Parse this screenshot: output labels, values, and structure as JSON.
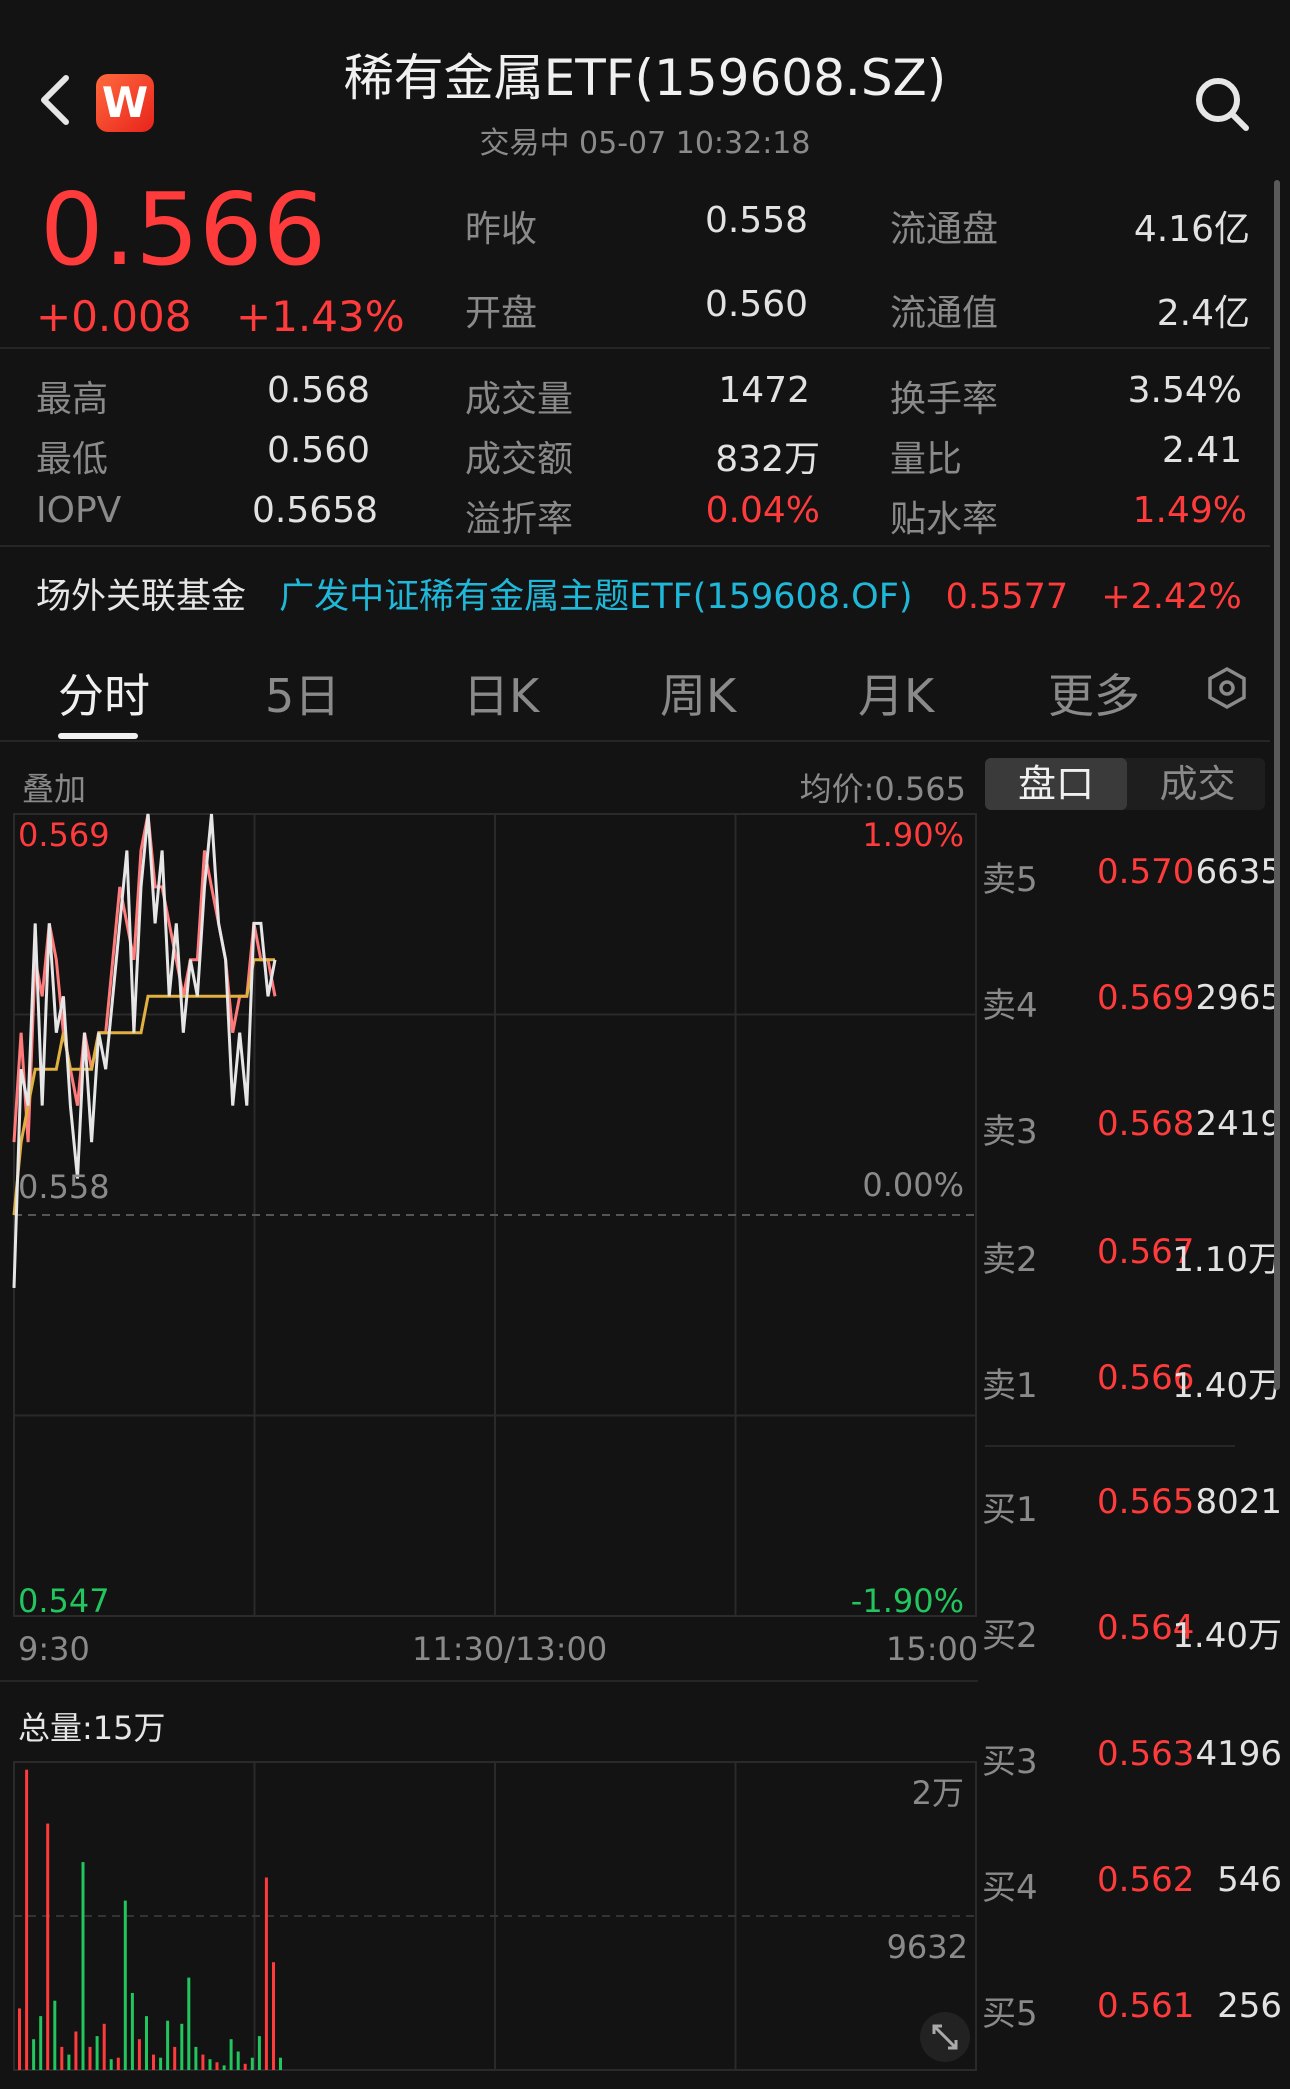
{
  "header": {
    "logo_letter": "W",
    "title": "稀有金属ETF(159608.SZ)",
    "subtitle": "交易中 05-07 10:32:18"
  },
  "quote": {
    "price": "0.566",
    "change": "+0.008",
    "change_pct": "+1.43%"
  },
  "stats_top": [
    {
      "label": "昨收",
      "value": "0.558",
      "label2": "流通盘",
      "value2": "4.16亿"
    },
    {
      "label": "开盘",
      "value": "0.560",
      "label2": "流通值",
      "value2": "2.4亿"
    }
  ],
  "stats": [
    {
      "l1": "最高",
      "v1": "0.568",
      "l2": "成交量",
      "v2": "1472",
      "l3": "换手率",
      "v3": "3.54%"
    },
    {
      "l1": "最低",
      "v1": "0.560",
      "l2": "成交额",
      "v2": "832万",
      "l3": "量比",
      "v3": "2.41"
    },
    {
      "l1": "IOPV",
      "v1": "0.5658",
      "l2": "溢折率",
      "v2": "0.04%",
      "l3": "贴水率",
      "v3": "1.49%"
    }
  ],
  "linked_fund": {
    "label": "场外关联基金",
    "name": "广发中证稀有金属主题ETF(159608.OF)",
    "price": "0.5577",
    "change": "+2.42%"
  },
  "tabs": [
    "分时",
    "5日",
    "日K",
    "周K",
    "月K",
    "更多"
  ],
  "active_tab": "分时",
  "chart": {
    "overlay_label": "叠加",
    "avg_label": "均价:0.565",
    "y_top": "0.569",
    "y_mid": "0.558",
    "y_bottom": "0.547",
    "pct_top": "1.90%",
    "pct_mid": "0.00%",
    "pct_bottom": "-1.90%",
    "x_start": "9:30",
    "x_mid": "11:30/13:00",
    "x_end": "15:00",
    "volume_label": "总量:15万",
    "vol_tick_top": "2万",
    "vol_tick_mid": "9632",
    "colors": {
      "up": "#ff3b3b",
      "down": "#22c55e",
      "price_line": "#e6e6e6",
      "avg_line": "#e0b040",
      "overlay_line": "#ff7b7b"
    }
  },
  "chart_data": {
    "type": "line",
    "title": "",
    "ylim": [
      0.547,
      0.569
    ],
    "x_range": [
      "9:30",
      "15:00"
    ],
    "series": [],
    "price_values": [
      0.556,
      0.562,
      0.561,
      0.566,
      0.561,
      0.566,
      0.563,
      0.564,
      0.561,
      0.559,
      0.563,
      0.56,
      0.563,
      0.562,
      0.564,
      0.566,
      0.568,
      0.563,
      0.567,
      0.569,
      0.566,
      0.568,
      0.564,
      0.566,
      0.563,
      0.565,
      0.564,
      0.567,
      0.569,
      0.566,
      0.565,
      0.561,
      0.563,
      0.561,
      0.566,
      0.566,
      0.564,
      0.565
    ],
    "avg_values": [
      0.558,
      0.56,
      0.561,
      0.562,
      0.562,
      0.562,
      0.562,
      0.563,
      0.562,
      0.562,
      0.562,
      0.562,
      0.563,
      0.563,
      0.563,
      0.563,
      0.563,
      0.563,
      0.563,
      0.564,
      0.564,
      0.564,
      0.564,
      0.564,
      0.564,
      0.564,
      0.564,
      0.564,
      0.564,
      0.564,
      0.564,
      0.564,
      0.564,
      0.564,
      0.565,
      0.565,
      0.565,
      0.565
    ],
    "overlay_values": [
      0.56,
      0.563,
      0.56,
      0.565,
      0.564,
      0.566,
      0.565,
      0.563,
      0.562,
      0.561,
      0.563,
      0.562,
      0.563,
      0.563,
      0.565,
      0.567,
      0.566,
      0.565,
      0.568,
      0.569,
      0.567,
      0.567,
      0.566,
      0.565,
      0.564,
      0.565,
      0.565,
      0.568,
      0.567,
      0.566,
      0.565,
      0.563,
      0.564,
      0.564,
      0.566,
      0.565,
      0.565,
      0.564
    ],
    "volume_values": [
      4000,
      19500,
      2000,
      3500,
      16000,
      4500,
      1500,
      1000,
      2500,
      13500,
      1500,
      2200,
      3000,
      700,
      800,
      11000,
      5000,
      2000,
      3500,
      1000,
      800,
      3200,
      1500,
      3000,
      6000,
      1500,
      1000,
      700,
      500,
      300,
      2000,
      1200,
      400,
      800,
      2200,
      12500,
      7000,
      800
    ],
    "volume_up": [
      1,
      1,
      0,
      0,
      1,
      0,
      1,
      0,
      1,
      0,
      1,
      0,
      1,
      0,
      1,
      0,
      0,
      1,
      0,
      1,
      0,
      0,
      1,
      0,
      0,
      0,
      1,
      0,
      1,
      0,
      0,
      0,
      1,
      0,
      0,
      1,
      1,
      0
    ],
    "volume_ylim": [
      0,
      20000
    ]
  },
  "order_book": {
    "tab_active": "盘口",
    "tab_other": "成交",
    "sells": [
      {
        "label": "卖5",
        "price": "0.570",
        "volume": "6635"
      },
      {
        "label": "卖4",
        "price": "0.569",
        "volume": "2965"
      },
      {
        "label": "卖3",
        "price": "0.568",
        "volume": "2419"
      },
      {
        "label": "卖2",
        "price": "0.567",
        "volume": "1.10万"
      },
      {
        "label": "卖1",
        "price": "0.566",
        "volume": "1.40万"
      }
    ],
    "buys": [
      {
        "label": "买1",
        "price": "0.565",
        "volume": "8021"
      },
      {
        "label": "买2",
        "price": "0.564",
        "volume": "1.40万"
      },
      {
        "label": "买3",
        "price": "0.563",
        "volume": "4196"
      },
      {
        "label": "买4",
        "price": "0.562",
        "volume": "546"
      },
      {
        "label": "买5",
        "price": "0.561",
        "volume": "256"
      }
    ]
  }
}
